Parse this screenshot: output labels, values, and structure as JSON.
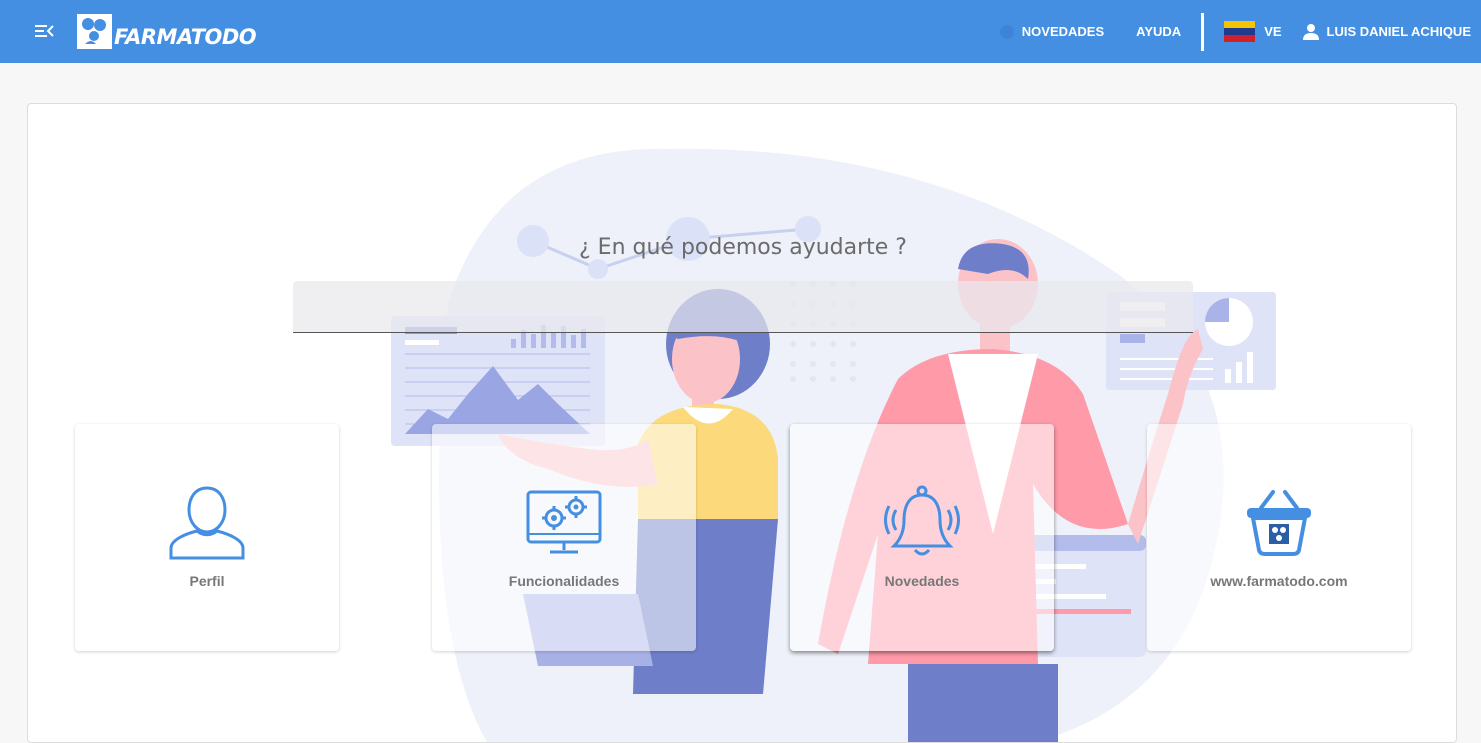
{
  "header": {
    "logo_text": "FARMATODO",
    "menu_icon": "menu-collapse-icon",
    "nav": {
      "novedades": "NOVEDADES",
      "ayuda": "AYUDA",
      "country_code": "VE",
      "user_name": "LUIS DANIEL ACHIQUE"
    },
    "colors": {
      "bar": "#448fe2",
      "text": "#ffffff"
    }
  },
  "main": {
    "help_title": "¿ En qué podemos ayudarte ?",
    "search": {
      "value": "",
      "placeholder": ""
    },
    "tiles": [
      {
        "label": "Perfil",
        "icon": "user-profile-icon"
      },
      {
        "label": "Funcionalidades",
        "icon": "monitor-gears-icon"
      },
      {
        "label": "Novedades",
        "icon": "bell-ringing-icon"
      },
      {
        "label": "www.farmatodo.com",
        "icon": "shopping-basket-icon"
      }
    ],
    "colors": {
      "icon": "#448fe2",
      "tile_label": "#777777"
    }
  }
}
